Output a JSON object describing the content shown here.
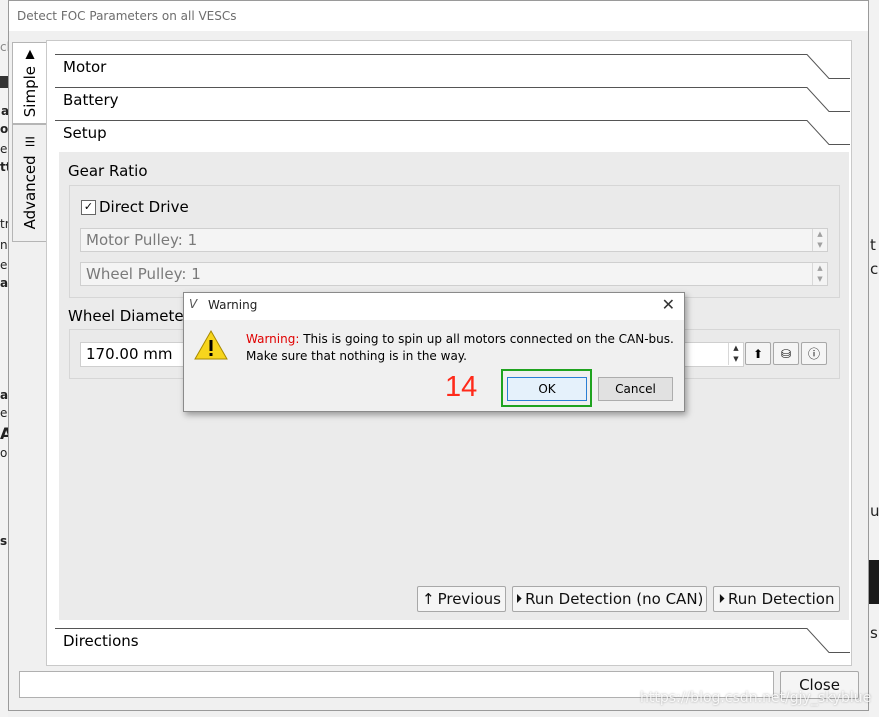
{
  "window": {
    "title": "Detect FOC Parameters on all VESCs"
  },
  "side_tabs": [
    {
      "label": "Simple",
      "icon": "road-icon"
    },
    {
      "label": "Advanced",
      "icon": "sliders-icon"
    }
  ],
  "sections": {
    "motor": "Motor",
    "battery": "Battery",
    "setup": "Setup",
    "directions": "Directions"
  },
  "setup": {
    "gear_ratio_label": "Gear Ratio",
    "direct_drive_label": "Direct Drive",
    "direct_drive_checked": true,
    "motor_pulley": "Motor Pulley: 1",
    "wheel_pulley": "Wheel Pulley: 1",
    "wheel_diameter_label": "Wheel Diameter",
    "wheel_diameter_value": "170.00 mm"
  },
  "nav_buttons": {
    "previous": "Previous",
    "run_no_can": "Run Detection (no CAN)",
    "run": "Run Detection"
  },
  "footer": {
    "close": "Close"
  },
  "warning_dialog": {
    "title": "Warning",
    "prefix": "Warning:",
    "line1": "This is going to spin up all motors connected on the CAN-bus.",
    "line2": "Make sure that nothing is in the way.",
    "ok": "OK",
    "cancel": "Cancel",
    "prefix_color": "#e00000"
  },
  "annotation": {
    "number": "14",
    "color": "#ff2a1a",
    "highlight_color": "#1fa31f"
  },
  "watermark": "https://blog.csdn.net/gjy_skyblue",
  "background_fragments": [
    "ck",
    "a",
    "o",
    "e",
    "tt",
    "tr",
    "ai",
    "e",
    "ni",
    "al",
    "e",
    "A",
    "oc",
    "s",
    "t",
    "c",
    "ut",
    "s"
  ]
}
